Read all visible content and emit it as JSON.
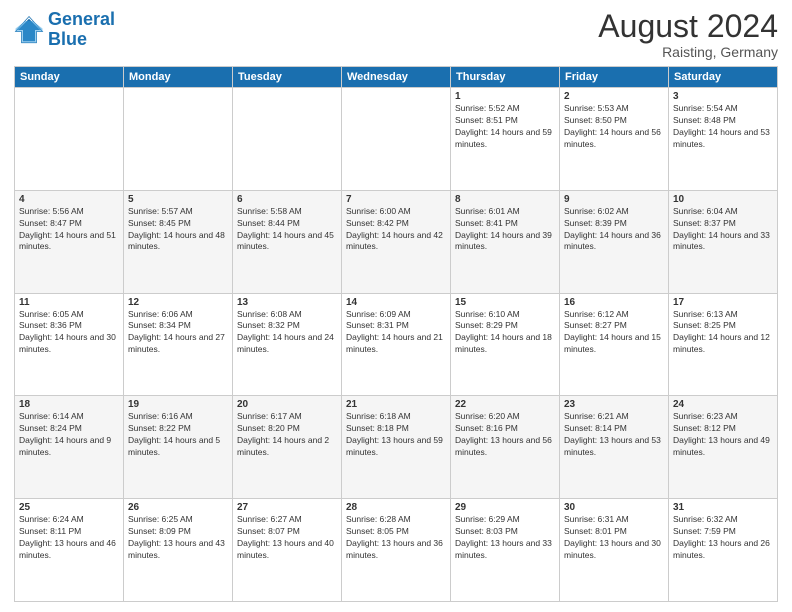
{
  "header": {
    "logo_line1": "General",
    "logo_line2": "Blue",
    "main_title": "August 2024",
    "subtitle": "Raisting, Germany"
  },
  "days_of_week": [
    "Sunday",
    "Monday",
    "Tuesday",
    "Wednesday",
    "Thursday",
    "Friday",
    "Saturday"
  ],
  "weeks": [
    [
      {
        "day": "",
        "info": ""
      },
      {
        "day": "",
        "info": ""
      },
      {
        "day": "",
        "info": ""
      },
      {
        "day": "",
        "info": ""
      },
      {
        "day": "1",
        "info": "Sunrise: 5:52 AM\nSunset: 8:51 PM\nDaylight: 14 hours and 59 minutes."
      },
      {
        "day": "2",
        "info": "Sunrise: 5:53 AM\nSunset: 8:50 PM\nDaylight: 14 hours and 56 minutes."
      },
      {
        "day": "3",
        "info": "Sunrise: 5:54 AM\nSunset: 8:48 PM\nDaylight: 14 hours and 53 minutes."
      }
    ],
    [
      {
        "day": "4",
        "info": "Sunrise: 5:56 AM\nSunset: 8:47 PM\nDaylight: 14 hours and 51 minutes."
      },
      {
        "day": "5",
        "info": "Sunrise: 5:57 AM\nSunset: 8:45 PM\nDaylight: 14 hours and 48 minutes."
      },
      {
        "day": "6",
        "info": "Sunrise: 5:58 AM\nSunset: 8:44 PM\nDaylight: 14 hours and 45 minutes."
      },
      {
        "day": "7",
        "info": "Sunrise: 6:00 AM\nSunset: 8:42 PM\nDaylight: 14 hours and 42 minutes."
      },
      {
        "day": "8",
        "info": "Sunrise: 6:01 AM\nSunset: 8:41 PM\nDaylight: 14 hours and 39 minutes."
      },
      {
        "day": "9",
        "info": "Sunrise: 6:02 AM\nSunset: 8:39 PM\nDaylight: 14 hours and 36 minutes."
      },
      {
        "day": "10",
        "info": "Sunrise: 6:04 AM\nSunset: 8:37 PM\nDaylight: 14 hours and 33 minutes."
      }
    ],
    [
      {
        "day": "11",
        "info": "Sunrise: 6:05 AM\nSunset: 8:36 PM\nDaylight: 14 hours and 30 minutes."
      },
      {
        "day": "12",
        "info": "Sunrise: 6:06 AM\nSunset: 8:34 PM\nDaylight: 14 hours and 27 minutes."
      },
      {
        "day": "13",
        "info": "Sunrise: 6:08 AM\nSunset: 8:32 PM\nDaylight: 14 hours and 24 minutes."
      },
      {
        "day": "14",
        "info": "Sunrise: 6:09 AM\nSunset: 8:31 PM\nDaylight: 14 hours and 21 minutes."
      },
      {
        "day": "15",
        "info": "Sunrise: 6:10 AM\nSunset: 8:29 PM\nDaylight: 14 hours and 18 minutes."
      },
      {
        "day": "16",
        "info": "Sunrise: 6:12 AM\nSunset: 8:27 PM\nDaylight: 14 hours and 15 minutes."
      },
      {
        "day": "17",
        "info": "Sunrise: 6:13 AM\nSunset: 8:25 PM\nDaylight: 14 hours and 12 minutes."
      }
    ],
    [
      {
        "day": "18",
        "info": "Sunrise: 6:14 AM\nSunset: 8:24 PM\nDaylight: 14 hours and 9 minutes."
      },
      {
        "day": "19",
        "info": "Sunrise: 6:16 AM\nSunset: 8:22 PM\nDaylight: 14 hours and 5 minutes."
      },
      {
        "day": "20",
        "info": "Sunrise: 6:17 AM\nSunset: 8:20 PM\nDaylight: 14 hours and 2 minutes."
      },
      {
        "day": "21",
        "info": "Sunrise: 6:18 AM\nSunset: 8:18 PM\nDaylight: 13 hours and 59 minutes."
      },
      {
        "day": "22",
        "info": "Sunrise: 6:20 AM\nSunset: 8:16 PM\nDaylight: 13 hours and 56 minutes."
      },
      {
        "day": "23",
        "info": "Sunrise: 6:21 AM\nSunset: 8:14 PM\nDaylight: 13 hours and 53 minutes."
      },
      {
        "day": "24",
        "info": "Sunrise: 6:23 AM\nSunset: 8:12 PM\nDaylight: 13 hours and 49 minutes."
      }
    ],
    [
      {
        "day": "25",
        "info": "Sunrise: 6:24 AM\nSunset: 8:11 PM\nDaylight: 13 hours and 46 minutes."
      },
      {
        "day": "26",
        "info": "Sunrise: 6:25 AM\nSunset: 8:09 PM\nDaylight: 13 hours and 43 minutes."
      },
      {
        "day": "27",
        "info": "Sunrise: 6:27 AM\nSunset: 8:07 PM\nDaylight: 13 hours and 40 minutes."
      },
      {
        "day": "28",
        "info": "Sunrise: 6:28 AM\nSunset: 8:05 PM\nDaylight: 13 hours and 36 minutes."
      },
      {
        "day": "29",
        "info": "Sunrise: 6:29 AM\nSunset: 8:03 PM\nDaylight: 13 hours and 33 minutes."
      },
      {
        "day": "30",
        "info": "Sunrise: 6:31 AM\nSunset: 8:01 PM\nDaylight: 13 hours and 30 minutes."
      },
      {
        "day": "31",
        "info": "Sunrise: 6:32 AM\nSunset: 7:59 PM\nDaylight: 13 hours and 26 minutes."
      }
    ]
  ]
}
